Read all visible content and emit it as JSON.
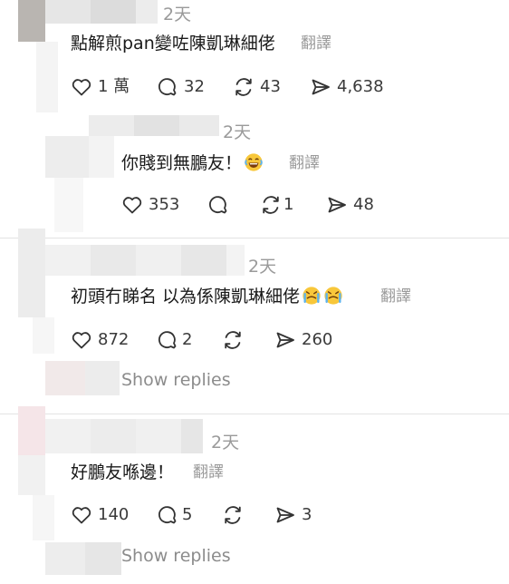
{
  "thread": {
    "posts": [
      {
        "time": "2天",
        "text": "點解煎pan變咗陳凱琳細佬",
        "translate_label": "翻譯",
        "likes": "1 萬",
        "comments": "32",
        "reposts": "43",
        "shares": "4,638"
      },
      {
        "time": "2天",
        "text": "你賤到無鵬友！",
        "emoji": "laughing-tears",
        "translate_label": "翻譯",
        "likes": "353",
        "comments": "",
        "reposts": "1",
        "shares": "48"
      },
      {
        "time": "2天",
        "text": "初頭冇睇名 以為係陳凱琳細佬",
        "emoji": "crying-face",
        "translate_label": "翻譯",
        "likes": "872",
        "comments": "2",
        "reposts": "",
        "shares": "260",
        "show_replies": "Show replies"
      },
      {
        "time": "2天",
        "text": "好鵬友喺邊！",
        "translate_label": "翻譯",
        "likes": "140",
        "comments": "5",
        "reposts": "",
        "shares": "3",
        "show_replies": "Show replies"
      }
    ]
  },
  "icons": {
    "like": "heart-icon",
    "comment": "comment-bubble-icon",
    "repost": "repost-icon",
    "share": "share-send-icon"
  },
  "colors": {
    "text": "#1a1a1a",
    "muted": "#9a9a9a",
    "icon": "#333333",
    "divider": "#e3e3e3"
  }
}
